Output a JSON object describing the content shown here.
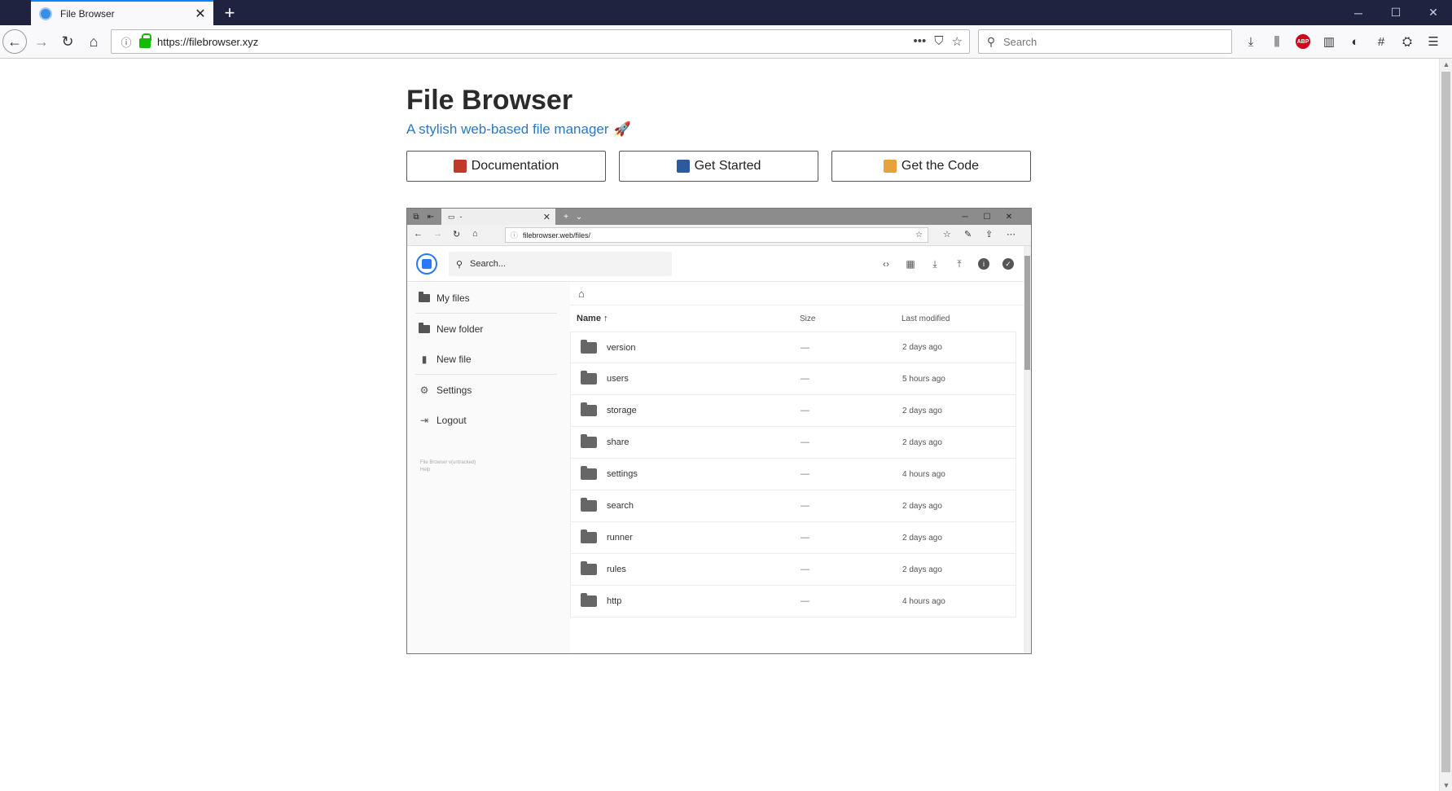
{
  "browser": {
    "tab_title": "File Browser",
    "url": "https://filebrowser.xyz",
    "search_placeholder": "Search"
  },
  "page": {
    "title": "File Browser",
    "subtitle": "A stylish web-based file manager",
    "buttons": [
      {
        "label": "Documentation",
        "emoji_color": "#c0392b"
      },
      {
        "label": "Get Started",
        "emoji_color": "#2c5aa0"
      },
      {
        "label": "Get the Code",
        "emoji_color": "#e6a23c"
      }
    ]
  },
  "screenshot": {
    "tab_title": "-",
    "url": "filebrowser.web/files/",
    "search_placeholder": "Search...",
    "sidebar": [
      {
        "label": "My files",
        "icon": "folder-icon"
      },
      {
        "label": "New folder",
        "icon": "new-folder-icon"
      },
      {
        "label": "New file",
        "icon": "new-file-icon"
      },
      {
        "label": "Settings",
        "icon": "settings-icon"
      },
      {
        "label": "Logout",
        "icon": "logout-icon"
      }
    ],
    "footer_version": "File Browser v(untracked)",
    "footer_help": "Help",
    "columns": {
      "name": "Name",
      "size": "Size",
      "modified": "Last modified"
    },
    "rows": [
      {
        "name": "version",
        "size": "—",
        "modified": "2 days ago"
      },
      {
        "name": "users",
        "size": "—",
        "modified": "5 hours ago"
      },
      {
        "name": "storage",
        "size": "—",
        "modified": "2 days ago"
      },
      {
        "name": "share",
        "size": "—",
        "modified": "2 days ago"
      },
      {
        "name": "settings",
        "size": "—",
        "modified": "4 hours ago"
      },
      {
        "name": "search",
        "size": "—",
        "modified": "2 days ago"
      },
      {
        "name": "runner",
        "size": "—",
        "modified": "2 days ago"
      },
      {
        "name": "rules",
        "size": "—",
        "modified": "2 days ago"
      },
      {
        "name": "http",
        "size": "—",
        "modified": "4 hours ago"
      }
    ]
  },
  "colors": {
    "accent": "#2979c5",
    "titlebar": "#202340"
  }
}
